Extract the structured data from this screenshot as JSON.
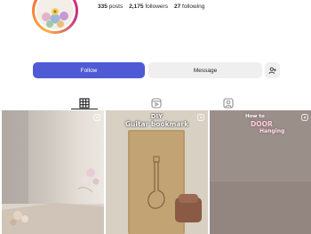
{
  "profile": {
    "posts_count": "335",
    "posts_label": "posts",
    "followers_count": "2,175",
    "followers_label": "followers",
    "following_count": "27",
    "following_label": "following"
  },
  "actions": {
    "follow_label": "Follow",
    "message_label": "Message",
    "suggest_icon": "add-person-icon"
  },
  "tabs": [
    {
      "icon": "grid-icon",
      "active": true
    },
    {
      "icon": "reels-icon",
      "active": false
    },
    {
      "icon": "tagged-icon",
      "active": false
    }
  ],
  "posts": [
    {
      "kind": "reel",
      "caption_lines": []
    },
    {
      "kind": "reel",
      "caption_lines": [
        "DIY",
        "Guitar bookmark"
      ]
    },
    {
      "kind": "reel",
      "caption_lines": [
        "How to",
        "DOOR",
        "Hanging"
      ]
    }
  ],
  "colors": {
    "follow_button": "#4f5bd5",
    "secondary_button": "#efefef",
    "text": "#262626"
  }
}
